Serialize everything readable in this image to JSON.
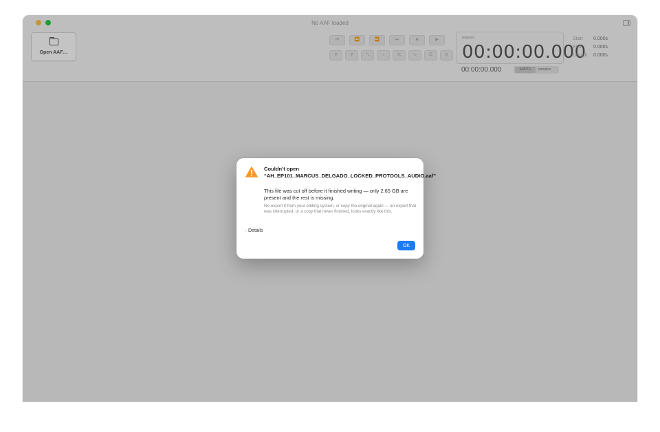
{
  "window": {
    "title": "No AAF loaded"
  },
  "toolbar": {
    "open_label": "Open AAF…",
    "transport_icons": [
      "skip-back-icon",
      "rewind-icon",
      "fast-forward-icon",
      "skip-forward-icon",
      "stop-icon",
      "play-icon"
    ],
    "tool_icons": [
      "zoom-out-icon",
      "zoom-in-icon",
      "fit-width-icon",
      "fit-height-icon",
      "fx-icon",
      "waveform-icon",
      "layers-icon",
      "target-icon"
    ]
  },
  "timecode": {
    "label": "Elapsed",
    "value": "00:00:00.000",
    "secondary": "00:00:00.000",
    "format_active": "SMPTE",
    "format_other": "samples"
  },
  "range": {
    "start_label": "Start",
    "start_value": "0.000s",
    "end_label": "End",
    "end_value": "0.000s",
    "length_label": "Length",
    "length_value": "0.000s"
  },
  "dialog": {
    "title": "Couldn’t open “AH_EP101_MARCUS_DELGADO_LOCKED_PROTOOLS_AUDIO.aaf”",
    "body": "This file was cut off before it finished writing — only 2.65 GB are present and the rest is missing.",
    "note": "Re-export it from your editing system, or copy the original again — an export that was interrupted, or a copy that never finished, looks exactly like this.",
    "details_label": "Details",
    "ok_label": "OK"
  },
  "colors": {
    "accent": "#1a7cf3",
    "warning": "#f39a2b",
    "traffic_yellow": "#f6c343",
    "traffic_green": "#27c93f"
  }
}
